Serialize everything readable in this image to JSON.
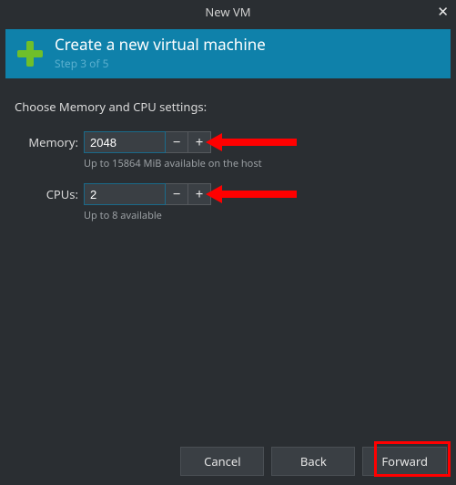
{
  "window": {
    "title": "New VM",
    "close_glyph": "✕"
  },
  "header": {
    "title": "Create a new virtual machine",
    "step": "Step 3 of 5"
  },
  "instruction": "Choose Memory and CPU settings:",
  "fields": {
    "memory": {
      "label": "Memory:",
      "value": "2048",
      "hint": "Up to 15864 MiB available on the host"
    },
    "cpus": {
      "label": "CPUs:",
      "value": "2",
      "hint": "Up to 8 available"
    }
  },
  "buttons": {
    "cancel": "Cancel",
    "back": "Back",
    "forward": "Forward"
  }
}
